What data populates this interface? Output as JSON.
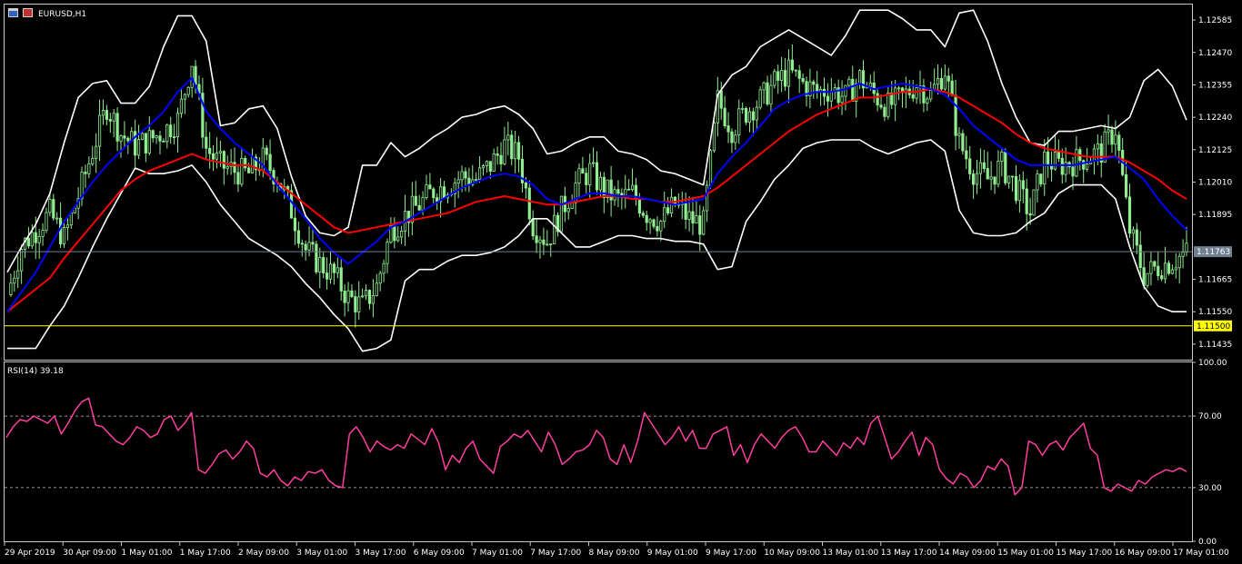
{
  "chart_title": "EURUSD,H1",
  "rsi_label": "RSI(14) 39.18",
  "colors": {
    "background": "#000000",
    "candles": "#90ee90",
    "bollinger": "#ffffff",
    "ma_fast": "#0000ff",
    "ma_slow": "#ff0000",
    "rsi": "#ff3ea0",
    "support_line": "#ffff00",
    "price_line": "#708090",
    "frame": "#c8c8c8"
  },
  "chart_data": [
    {
      "type": "line",
      "title": "EURUSD,H1",
      "xlabel": "",
      "ylabel": "",
      "ylim": [
        1.1138,
        1.1264
      ],
      "y_ticks": [
        "1.12585",
        "1.12470",
        "1.12355",
        "1.12240",
        "1.12125",
        "1.12010",
        "1.11895",
        "1.11665",
        "1.11550",
        "1.11435"
      ],
      "x_ticks": [
        "29 Apr 2019",
        "30 Apr 09:00",
        "1 May 01:00",
        "1 May 17:00",
        "2 May 09:00",
        "3 May 01:00",
        "3 May 17:00",
        "6 May 09:00",
        "7 May 01:00",
        "7 May 17:00",
        "8 May 09:00",
        "9 May 01:00",
        "9 May 17:00",
        "10 May 09:00",
        "13 May 01:00",
        "13 May 17:00",
        "14 May 09:00",
        "15 May 01:00",
        "15 May 17:00",
        "16 May 09:00",
        "17 May 01:00"
      ],
      "current_price": {
        "value": 1.11763,
        "label": "1.11763"
      },
      "horizontal_line": {
        "value": 1.115,
        "label": "1.11500"
      },
      "series": [
        {
          "name": "",
          "key": "close",
          "values": [
            1.1161,
            1.1178,
            1.1184,
            1.119,
            1.1181,
            1.1196,
            1.1212,
            1.1228,
            1.1218,
            1.1214,
            1.1216,
            1.1219,
            1.1223,
            1.1244,
            1.1213,
            1.1207,
            1.1205,
            1.1204,
            1.1209,
            1.1203,
            1.1191,
            1.1177,
            1.1172,
            1.1168,
            1.116,
            1.1157,
            1.1164,
            1.1184,
            1.1189,
            1.1193,
            1.1198,
            1.12,
            1.1203,
            1.1202,
            1.1207,
            1.1214,
            1.121,
            1.1186,
            1.118,
            1.1191,
            1.12,
            1.1205,
            1.1198,
            1.1195,
            1.1197,
            1.119,
            1.1187,
            1.1193,
            1.1188,
            1.1186,
            1.123,
            1.122,
            1.1226,
            1.123,
            1.1236,
            1.124,
            1.1236,
            1.1233,
            1.1234,
            1.1231,
            1.1238,
            1.1232,
            1.1228,
            1.1231,
            1.1236,
            1.1232,
            1.1241,
            1.1215,
            1.1205,
            1.1202,
            1.1207,
            1.1199,
            1.119,
            1.1209,
            1.1207,
            1.1208,
            1.121,
            1.1212,
            1.122,
            1.1184,
            1.1168,
            1.1171,
            1.1173,
            1.1176
          ]
        },
        {
          "name": "",
          "key": "ma_fast",
          "values": [
            1.1155,
            1.1162,
            1.1169,
            1.1178,
            1.1187,
            1.1194,
            1.1201,
            1.1207,
            1.1212,
            1.1217,
            1.1221,
            1.1226,
            1.1233,
            1.1238,
            1.1226,
            1.122,
            1.1215,
            1.1211,
            1.1207,
            1.12,
            1.1194,
            1.1188,
            1.1181,
            1.1176,
            1.1172,
            1.1176,
            1.118,
            1.1185,
            1.1187,
            1.119,
            1.1193,
            1.1196,
            1.1199,
            1.1201,
            1.1203,
            1.1204,
            1.1203,
            1.12,
            1.1195,
            1.1193,
            1.1195,
            1.1197,
            1.1197,
            1.1196,
            1.1196,
            1.1195,
            1.1194,
            1.1193,
            1.1194,
            1.1195,
            1.1204,
            1.121,
            1.1215,
            1.1221,
            1.1227,
            1.123,
            1.1232,
            1.1233,
            1.1233,
            1.1234,
            1.1236,
            1.1234,
            1.1235,
            1.1236,
            1.1235,
            1.1234,
            1.1232,
            1.1227,
            1.1221,
            1.1217,
            1.1213,
            1.1209,
            1.1207,
            1.1207,
            1.1207,
            1.1207,
            1.1208,
            1.1209,
            1.121,
            1.1206,
            1.1202,
            1.1195,
            1.1189,
            1.1184
          ]
        },
        {
          "name": "",
          "key": "ma_slow",
          "values": [
            1.1155,
            1.1159,
            1.1163,
            1.1167,
            1.1174,
            1.118,
            1.1186,
            1.1192,
            1.1198,
            1.1202,
            1.1205,
            1.1207,
            1.1209,
            1.1211,
            1.1209,
            1.1208,
            1.1207,
            1.1207,
            1.1205,
            1.1201,
            1.1197,
            1.1193,
            1.1189,
            1.1185,
            1.1183,
            1.1184,
            1.1185,
            1.1186,
            1.1187,
            1.1188,
            1.1189,
            1.119,
            1.1192,
            1.1194,
            1.1195,
            1.1196,
            1.1195,
            1.1194,
            1.1193,
            1.1193,
            1.1194,
            1.1195,
            1.1196,
            1.1196,
            1.1195,
            1.1195,
            1.1194,
            1.1194,
            1.1195,
            1.1196,
            1.1199,
            1.1203,
            1.1207,
            1.1211,
            1.1215,
            1.1219,
            1.1222,
            1.1225,
            1.1227,
            1.1229,
            1.1231,
            1.1231,
            1.1232,
            1.1233,
            1.1233,
            1.1234,
            1.1233,
            1.1231,
            1.1228,
            1.1225,
            1.1222,
            1.1218,
            1.1215,
            1.1213,
            1.1212,
            1.1211,
            1.121,
            1.121,
            1.121,
            1.1208,
            1.1205,
            1.1202,
            1.1198,
            1.1195
          ]
        },
        {
          "name": "",
          "key": "bb_upper",
          "values": [
            1.1169,
            1.1178,
            1.1186,
            1.1197,
            1.1215,
            1.1231,
            1.1236,
            1.1237,
            1.1229,
            1.1229,
            1.1235,
            1.1249,
            1.126,
            1.126,
            1.1251,
            1.1221,
            1.1222,
            1.1227,
            1.1228,
            1.122,
            1.1203,
            1.1189,
            1.1183,
            1.1182,
            1.1185,
            1.1207,
            1.1207,
            1.1215,
            1.121,
            1.1213,
            1.1217,
            1.122,
            1.1224,
            1.1225,
            1.1227,
            1.1228,
            1.1225,
            1.122,
            1.1211,
            1.1212,
            1.1215,
            1.1217,
            1.1217,
            1.1212,
            1.1211,
            1.1209,
            1.1205,
            1.1204,
            1.1202,
            1.12,
            1.1232,
            1.1239,
            1.1242,
            1.1249,
            1.1252,
            1.1255,
            1.1252,
            1.1249,
            1.1246,
            1.1253,
            1.1262,
            1.1262,
            1.1262,
            1.1259,
            1.1255,
            1.1255,
            1.1249,
            1.1261,
            1.1262,
            1.1251,
            1.1236,
            1.1224,
            1.1215,
            1.1214,
            1.1219,
            1.1219,
            1.122,
            1.1221,
            1.122,
            1.1224,
            1.1237,
            1.1241,
            1.1235,
            1.1223
          ]
        },
        {
          "name": "",
          "key": "bb_lower",
          "values": [
            1.1142,
            1.1142,
            1.1142,
            1.115,
            1.1157,
            1.1167,
            1.1178,
            1.1188,
            1.1197,
            1.1206,
            1.1204,
            1.1204,
            1.1205,
            1.1207,
            1.1201,
            1.1193,
            1.1187,
            1.1181,
            1.1178,
            1.1175,
            1.1171,
            1.1165,
            1.116,
            1.1154,
            1.1149,
            1.1141,
            1.1142,
            1.1145,
            1.1166,
            1.117,
            1.117,
            1.1173,
            1.1175,
            1.1175,
            1.1176,
            1.1178,
            1.1182,
            1.1188,
            1.1188,
            1.1183,
            1.1178,
            1.1178,
            1.118,
            1.1182,
            1.1182,
            1.1181,
            1.1181,
            1.118,
            1.118,
            1.1179,
            1.117,
            1.1171,
            1.1187,
            1.1194,
            1.1202,
            1.1207,
            1.1213,
            1.1215,
            1.1216,
            1.1216,
            1.1216,
            1.1213,
            1.1211,
            1.1213,
            1.1215,
            1.1216,
            1.1212,
            1.1191,
            1.1183,
            1.1182,
            1.1182,
            1.1183,
            1.1187,
            1.119,
            1.1197,
            1.12,
            1.12,
            1.12,
            1.1195,
            1.1178,
            1.1164,
            1.1157,
            1.1155,
            1.1155
          ]
        }
      ]
    },
    {
      "type": "line",
      "title": "RSI(14) 39.18",
      "xlabel": "",
      "ylabel": "",
      "ylim": [
        0,
        100
      ],
      "y_ticks": [
        "100.00",
        "70.00",
        "30.00",
        "0.00"
      ],
      "levels": [
        70,
        30
      ],
      "series": [
        {
          "name": "",
          "values": [
            58,
            64,
            68,
            67,
            70,
            68,
            66,
            70,
            60,
            66,
            73,
            78,
            80,
            65,
            64,
            60,
            56,
            54,
            58,
            64,
            62,
            58,
            60,
            68,
            70,
            62,
            66,
            72,
            40,
            38,
            43,
            49,
            51,
            46,
            50,
            56,
            52,
            38,
            36,
            40,
            34,
            31,
            36,
            34,
            39,
            38,
            40,
            34,
            31,
            30,
            60,
            64,
            58,
            50,
            56,
            53,
            51,
            54,
            52,
            60,
            57,
            54,
            63,
            55,
            40,
            48,
            44,
            52,
            56,
            46,
            42,
            38,
            53,
            56,
            60,
            58,
            62,
            56,
            50,
            61,
            54,
            43,
            46,
            50,
            51,
            54,
            62,
            58,
            46,
            43,
            54,
            44,
            56,
            72,
            66,
            60,
            54,
            58,
            64,
            56,
            62,
            52,
            52,
            60,
            62,
            64,
            48,
            54,
            44,
            54,
            60,
            56,
            52,
            58,
            62,
            64,
            58,
            50,
            50,
            56,
            52,
            48,
            55,
            52,
            58,
            54,
            66,
            70,
            58,
            46,
            50,
            56,
            61,
            48,
            58,
            54,
            40,
            35,
            32,
            38,
            36,
            30,
            34,
            42,
            40,
            46,
            42,
            26,
            30,
            56,
            54,
            48,
            54,
            56,
            51,
            58,
            62,
            66,
            52,
            48,
            30,
            28,
            32,
            30,
            28,
            34,
            32,
            36,
            38,
            40,
            39,
            41,
            39
          ]
        }
      ]
    }
  ]
}
